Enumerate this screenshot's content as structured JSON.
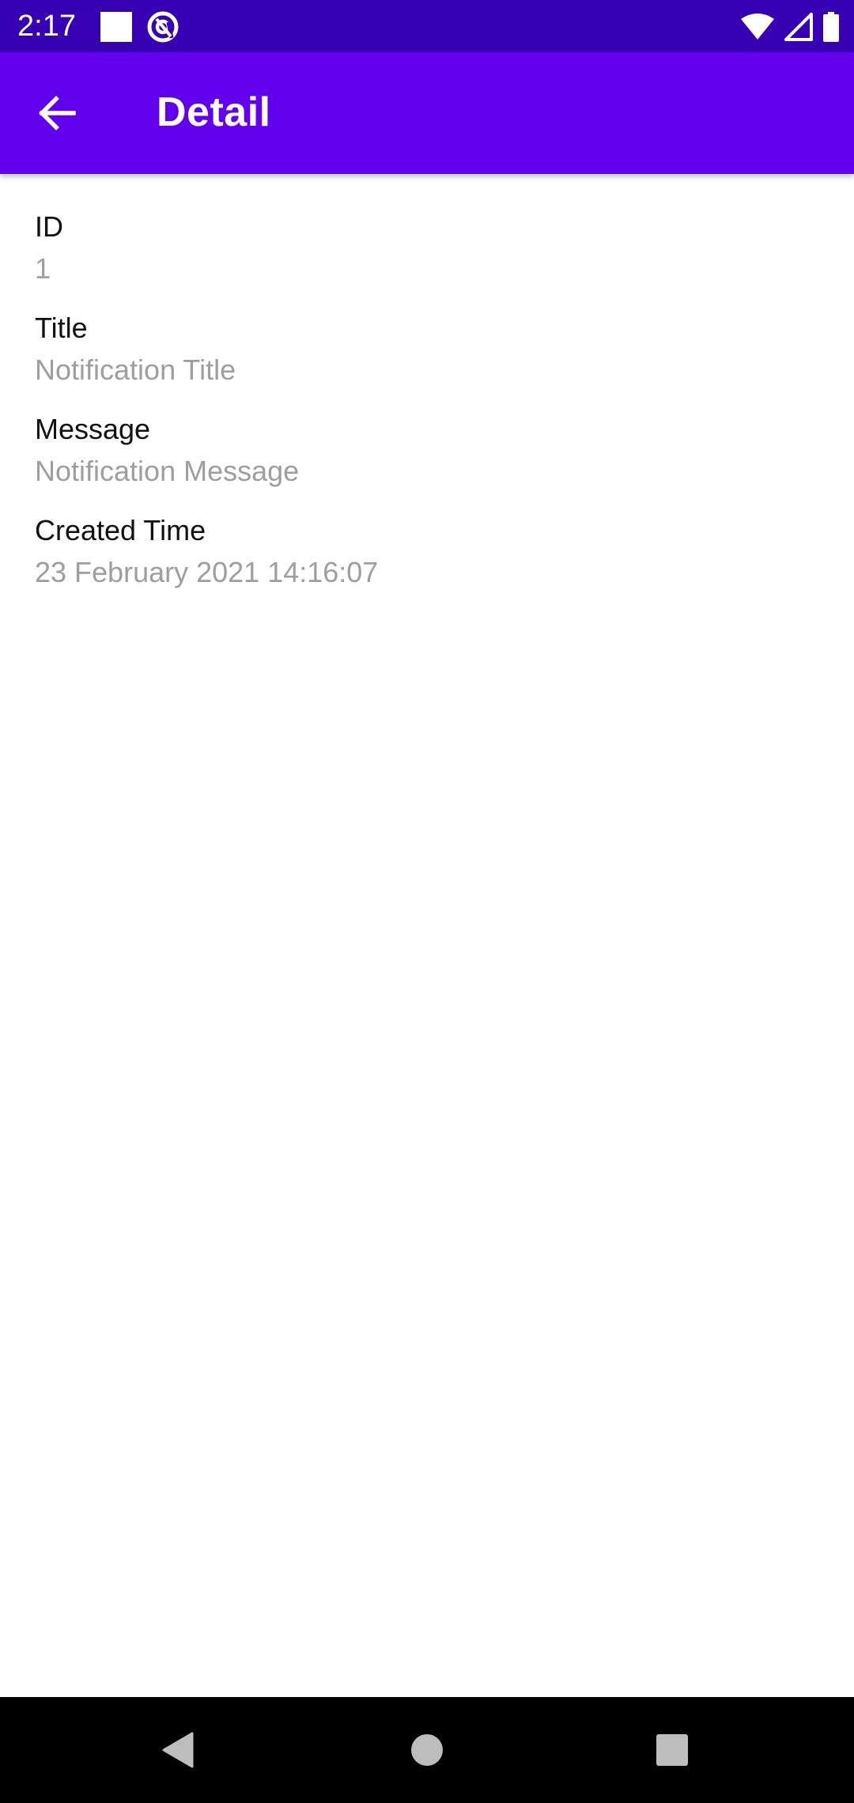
{
  "status_bar": {
    "time": "2:17",
    "icons": [
      "notification-square-icon",
      "at-sign-icon",
      "wifi-icon",
      "signal-icon",
      "battery-icon"
    ]
  },
  "app_bar": {
    "title": "Detail",
    "back_icon": "arrow-back-icon"
  },
  "fields": [
    {
      "label": "ID",
      "value": "1"
    },
    {
      "label": "Title",
      "value": "Notification Title"
    },
    {
      "label": "Message",
      "value": "Notification Message"
    },
    {
      "label": "Created Time",
      "value": "23 February 2021 14:16:07"
    }
  ],
  "nav_bar": {
    "buttons": [
      "back-triangle-icon",
      "home-circle-icon",
      "recents-square-icon"
    ]
  },
  "colors": {
    "status_bar": "#3700B3",
    "app_bar": "#6200EE",
    "label_text": "#111111",
    "value_text": "#9E9E9E",
    "nav_bar": "#000000",
    "nav_icons": "#BDBDBD"
  }
}
